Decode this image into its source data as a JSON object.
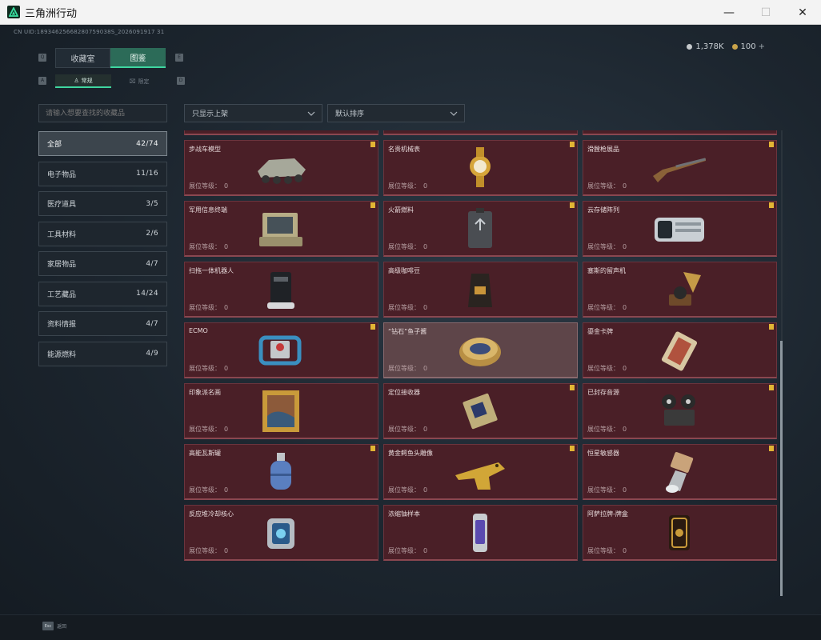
{
  "window": {
    "title": "三角洲行动",
    "controls": {
      "minimize": "—",
      "maximize": "☐",
      "close": "✕"
    }
  },
  "header": {
    "uid": "CN UID:18934625668280759038S_2026091917 31",
    "currency": [
      {
        "icon": "silver-coin-icon",
        "value": "1,378K"
      },
      {
        "icon": "gold-coin-icon",
        "value": "100"
      }
    ],
    "currency_plus": "+"
  },
  "tabs": [
    {
      "label": "收藏室",
      "active": false
    },
    {
      "label": "图鉴",
      "active": true
    }
  ],
  "tab_keys": {
    "prev": "Q",
    "next": "E",
    "sub_prev": "A",
    "sub_next": "D"
  },
  "subtabs": [
    {
      "label": "常规",
      "active": true
    },
    {
      "label": "限定",
      "active": false
    }
  ],
  "search": {
    "placeholder": "请输入想要查找的收藏品"
  },
  "filters": {
    "shelf": "只显示上架",
    "sort": "默认排序"
  },
  "categories": [
    {
      "label": "全部",
      "count": "42/74",
      "active": true
    },
    {
      "label": "电子物品",
      "count": "11/16"
    },
    {
      "label": "医疗道具",
      "count": "3/5"
    },
    {
      "label": "工具材料",
      "count": "2/6"
    },
    {
      "label": "家居物品",
      "count": "4/7"
    },
    {
      "label": "工艺藏品",
      "count": "14/24"
    },
    {
      "label": "资料情报",
      "count": "4/7"
    },
    {
      "label": "能源燃料",
      "count": "4/9"
    }
  ],
  "level_label": "展位等级：",
  "items": [
    {
      "name": "",
      "level": "0",
      "flag": false,
      "icon": "tank-model-icon"
    },
    {
      "name": "",
      "level": "0",
      "flag": false,
      "icon": "circuit-board-icon"
    },
    {
      "name": "",
      "level": "0",
      "flag": false,
      "icon": "red-device-icon"
    },
    {
      "name": "步战车模型",
      "level": "0",
      "flag": true,
      "icon": "ifv-model-icon"
    },
    {
      "name": "名贵机械表",
      "level": "0",
      "flag": true,
      "icon": "watch-icon"
    },
    {
      "name": "滑膛枪展品",
      "level": "0",
      "flag": true,
      "icon": "musket-icon"
    },
    {
      "name": "军用信息终端",
      "level": "0",
      "flag": true,
      "icon": "military-terminal-icon"
    },
    {
      "name": "火箭燃料",
      "level": "0",
      "flag": true,
      "icon": "fuel-can-icon"
    },
    {
      "name": "云存储阵列",
      "level": "0",
      "flag": true,
      "icon": "storage-array-icon"
    },
    {
      "name": "扫拖一体机器人",
      "level": "0",
      "flag": false,
      "icon": "robot-vacuum-icon"
    },
    {
      "name": "高级咖啡豆",
      "level": "0",
      "flag": false,
      "icon": "coffee-bag-icon"
    },
    {
      "name": "塞斯的留声机",
      "level": "0",
      "flag": false,
      "icon": "gramophone-icon"
    },
    {
      "name": "ECMO",
      "level": "0",
      "flag": true,
      "icon": "ecmo-icon"
    },
    {
      "name": "“钻石”鱼子酱",
      "level": "0",
      "flag": false,
      "icon": "caviar-tin-icon",
      "highlight": true
    },
    {
      "name": "鎏金卡牌",
      "level": "0",
      "flag": true,
      "icon": "gold-card-icon"
    },
    {
      "name": "印象派名画",
      "level": "0",
      "flag": false,
      "icon": "painting-icon"
    },
    {
      "name": "定位接收器",
      "level": "0",
      "flag": true,
      "icon": "receiver-icon"
    },
    {
      "name": "已封存音源",
      "level": "0",
      "flag": true,
      "icon": "film-projector-icon"
    },
    {
      "name": "高能瓦斯罐",
      "level": "0",
      "flag": true,
      "icon": "gas-tank-icon"
    },
    {
      "name": "黄金鳄鱼头雕像",
      "level": "0",
      "flag": true,
      "icon": "gold-croc-icon"
    },
    {
      "name": "恒星敏感器",
      "level": "0",
      "flag": true,
      "icon": "star-sensor-icon"
    },
    {
      "name": "反应堆冷却核心",
      "level": "0",
      "flag": false,
      "icon": "reactor-core-icon"
    },
    {
      "name": "浓缩铀样本",
      "level": "0",
      "flag": false,
      "icon": "uranium-sample-icon"
    },
    {
      "name": "阿萨拉牌-牌盒",
      "level": "0",
      "flag": false,
      "icon": "card-box-icon"
    }
  ],
  "footer": {
    "key": "Esc",
    "label": "返回"
  },
  "colors": {
    "accent": "#3fd6a0",
    "card_bg": "#4a1f27",
    "flag": "#e2b534"
  }
}
